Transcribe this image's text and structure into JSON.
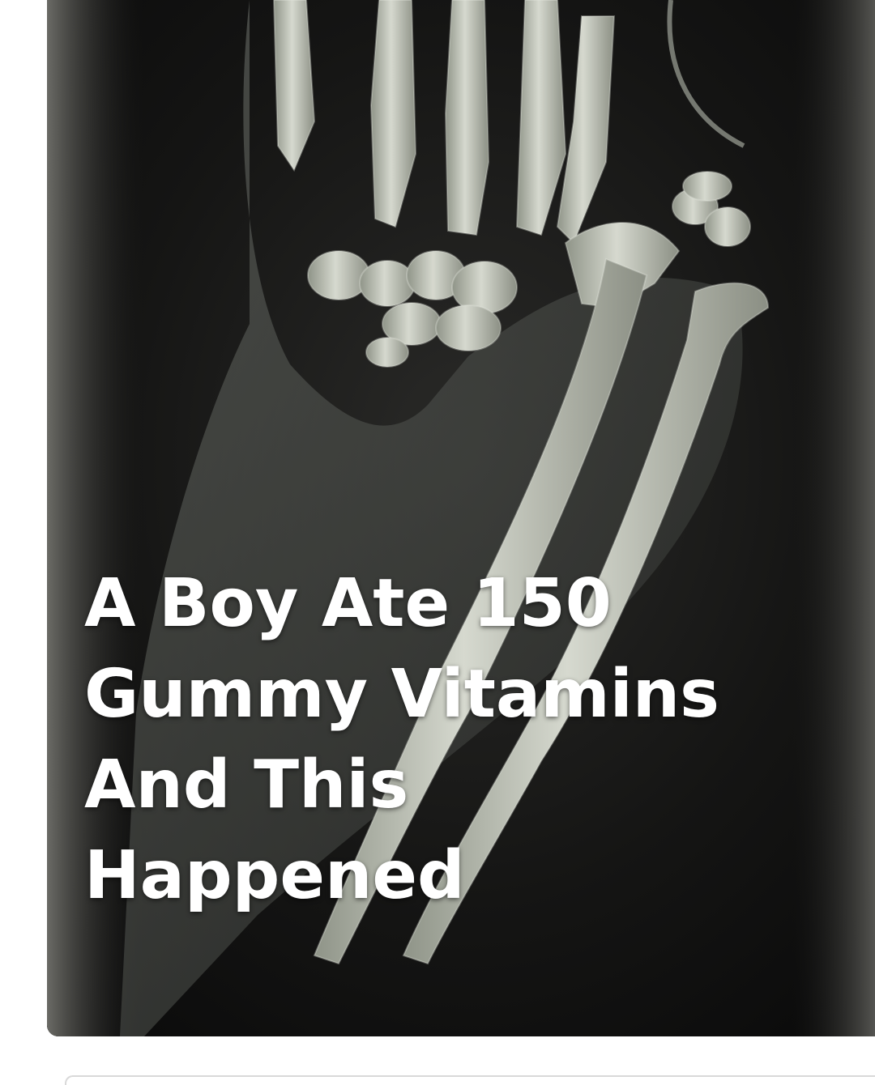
{
  "post": {
    "image_description_icon": "xray-forearm-image",
    "headline_lines": [
      "A Boy Ate 150",
      "Gummy Vitamins",
      "And This",
      "Happened"
    ]
  },
  "colors": {
    "page_background": "#ffffff",
    "card_background": "#121212",
    "headline_text": "#ffffff"
  }
}
